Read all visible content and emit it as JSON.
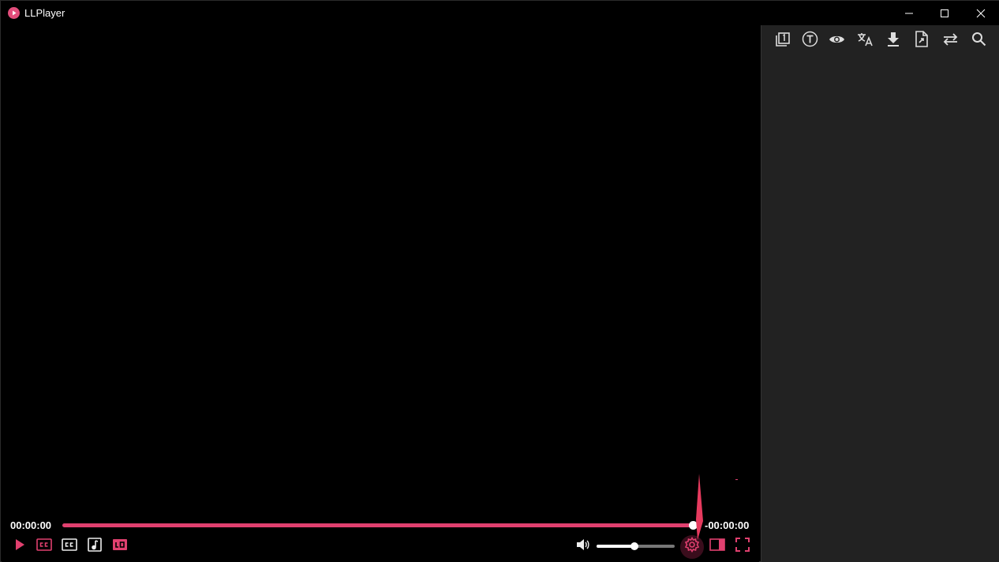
{
  "window": {
    "title": "LLPlayer",
    "accent_color": "#e0406f"
  },
  "sidebar": {
    "toolbar": [
      {
        "icon": "subtitle-list-icon"
      },
      {
        "icon": "text-icon"
      },
      {
        "icon": "eye-icon"
      },
      {
        "icon": "translate-icon"
      },
      {
        "icon": "download-icon"
      },
      {
        "icon": "export-file-icon"
      },
      {
        "icon": "swap-icon"
      },
      {
        "icon": "search-icon"
      }
    ]
  },
  "player": {
    "current_time": "00:00:00",
    "remaining_time": "-00:00:00",
    "progress": 1.0,
    "volume": 0.5,
    "controls": [
      {
        "icon": "play-icon"
      },
      {
        "icon": "primary-subtitle-icon"
      },
      {
        "icon": "secondary-subtitle-icon"
      },
      {
        "icon": "audio-track-icon"
      },
      {
        "icon": "ai-subtitle-icon"
      },
      {
        "icon": "volume-icon"
      },
      {
        "icon": "settings-icon"
      },
      {
        "icon": "sidebar-toggle-icon"
      },
      {
        "icon": "fullscreen-icon"
      }
    ]
  }
}
